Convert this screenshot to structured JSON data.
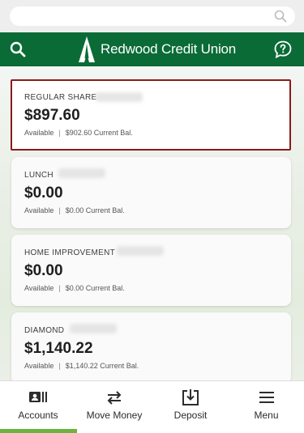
{
  "browser": {
    "search_icon": "search-icon"
  },
  "header": {
    "brand_name": "Redwood Credit Union",
    "brand_color": "#0a6b37",
    "search_icon": "search-icon",
    "help_icon": "help-chat-icon"
  },
  "accounts": [
    {
      "name": "REGULAR SHARE",
      "balance": "$897.60",
      "available_label": "Available",
      "separator": "|",
      "current": "$902.60 Current Bal."
    },
    {
      "name": "LUNCH",
      "balance": "$0.00",
      "available_label": "Available",
      "separator": "|",
      "current": "$0.00 Current Bal."
    },
    {
      "name": "HOME IMPROVEMENT",
      "balance": "$0.00",
      "available_label": "Available",
      "separator": "|",
      "current": "$0.00 Current Bal."
    },
    {
      "name": "DIAMOND",
      "balance": "$1,140.22",
      "available_label": "Available",
      "separator": "|",
      "current": "$1,140.22 Current Bal."
    }
  ],
  "nav": {
    "items": [
      {
        "label": "Accounts",
        "icon": "accounts-icon"
      },
      {
        "label": "Move Money",
        "icon": "transfer-arrows-icon"
      },
      {
        "label": "Deposit",
        "icon": "deposit-icon"
      },
      {
        "label": "Menu",
        "icon": "hamburger-menu-icon"
      }
    ],
    "active_color": "#6cb33f"
  },
  "colors": {
    "selected_border": "#8b1a1a"
  }
}
